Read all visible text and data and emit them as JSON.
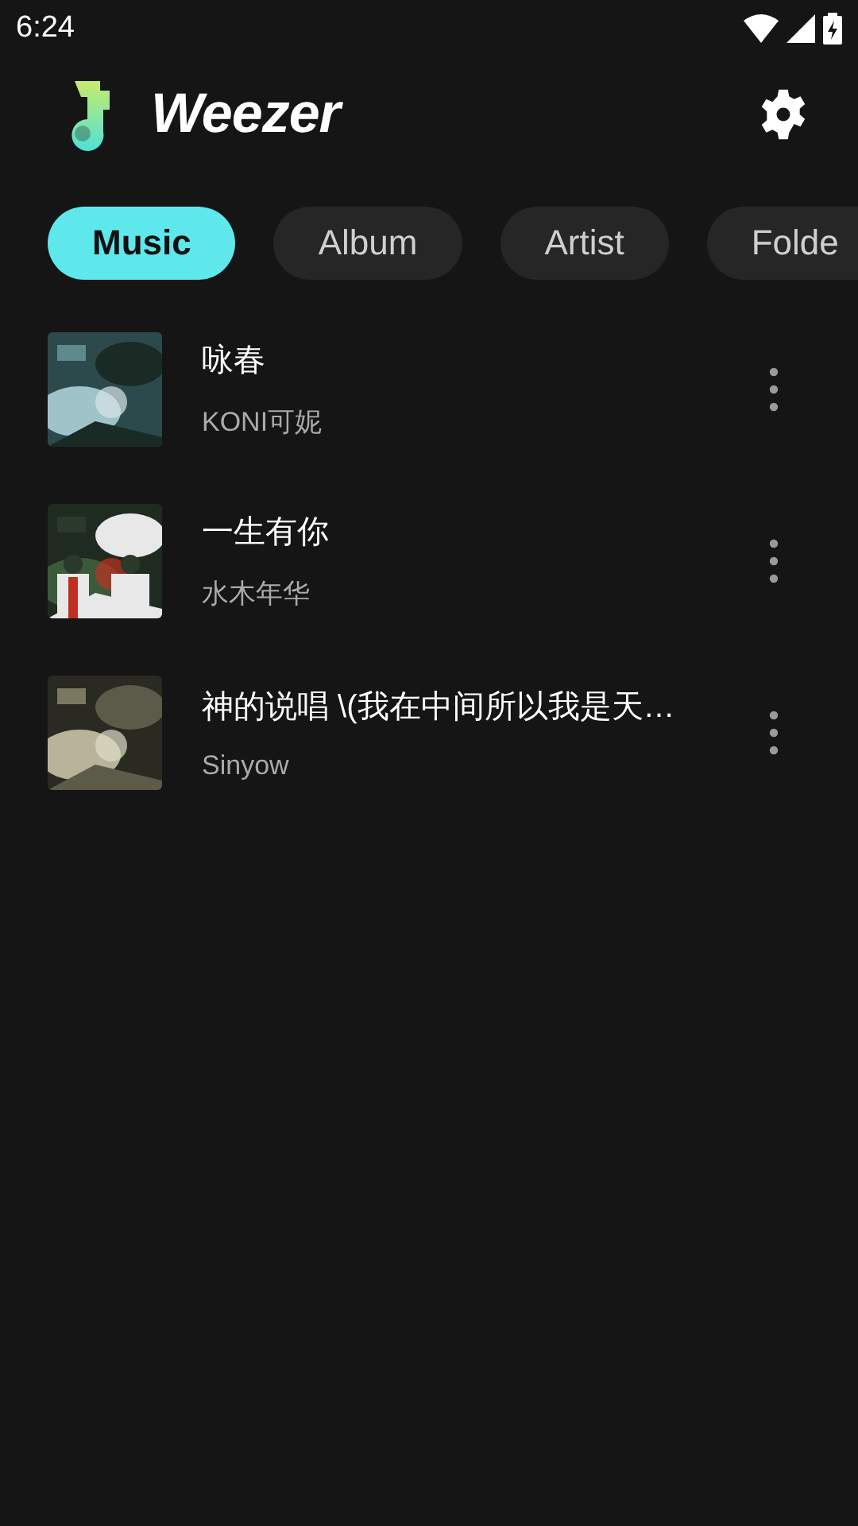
{
  "status_bar": {
    "time": "6:24"
  },
  "app_bar": {
    "title": "Weezer"
  },
  "tabs": [
    {
      "label": "Music",
      "selected": true
    },
    {
      "label": "Album",
      "selected": false
    },
    {
      "label": "Artist",
      "selected": false
    },
    {
      "label": "Folde",
      "selected": false
    }
  ],
  "songs": [
    {
      "title": "咏春",
      "artist": "KONI可妮"
    },
    {
      "title": "一生有你",
      "artist": "水木年华"
    },
    {
      "title": "神的说唱 \\(我在中间所以我是天…",
      "artist": "Sinyow"
    }
  ]
}
